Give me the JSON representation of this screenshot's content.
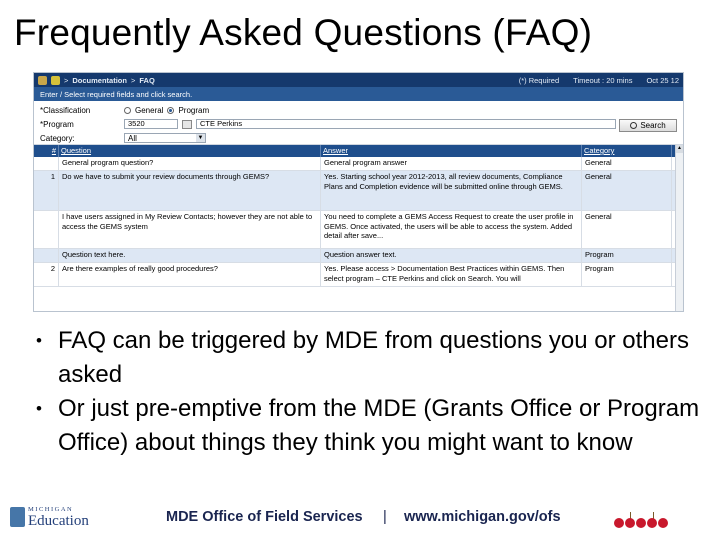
{
  "slide": {
    "title": "Frequently Asked Questions  (FAQ)",
    "bullets": [
      "FAQ can be triggered by MDE from questions you or others asked",
      "Or just pre-emptive from the MDE (Grants Office or Program Office) about things they think you might want to know"
    ],
    "bullet_glyph": "•"
  },
  "app": {
    "breadcrumb": [
      "Documentation",
      "FAQ"
    ],
    "crumb_sep": ">",
    "required_note": "(*) Required",
    "timeout": "Timeout : 20 mins",
    "date": "Oct 25 12",
    "instructions": "Enter / Select required fields and click search.",
    "form": {
      "classification_label": "*Classification",
      "classification_options": [
        "General",
        "Program"
      ],
      "classification_selected": "Program",
      "program_label": "*Program",
      "program_code": "3520",
      "program_name": "CTE Perkins",
      "category_label": "Category:",
      "category_value": "All",
      "search_label": "Search"
    },
    "grid": {
      "columns": [
        "#",
        "Question",
        "Answer",
        "Category"
      ],
      "rows": [
        {
          "num": "",
          "question": "General program question?",
          "answer": "General program answer",
          "category": "General",
          "highlight": false
        },
        {
          "num": "1",
          "question": "Do we have to submit your review documents through GEMS?",
          "answer": "Yes. Starting school year 2012-2013, all review documents, Compliance Plans and Completion evidence will be submitted online through GEMS.",
          "category": "General",
          "highlight": true
        },
        {
          "num": "",
          "question": "I have users assigned in My Review Contacts; however they are not able to access the GEMS system",
          "answer": "You need to complete a GEMS Access Request to create the user profile in GEMS. Once activated, the users will be able to access the system. Added detail after save...",
          "category": "General",
          "highlight": false
        },
        {
          "num": "",
          "question": "Question text here.",
          "answer": "Question answer text.",
          "category": "Program",
          "highlight": true
        },
        {
          "num": "2",
          "question": "Are there examples of really good procedures?",
          "answer": "Yes. Please access > Documentation Best Practices within GEMS. Then select program – CTE Perkins and click on Search. You will",
          "category": "Program",
          "highlight": false
        }
      ]
    }
  },
  "footer": {
    "logo_small": "MICHIGAN",
    "logo_big": "Education",
    "office": "MDE Office of Field Services",
    "separator": "|",
    "url": "www.michigan.gov/ofs"
  },
  "colors": {
    "header_navy": "#15396d",
    "instruction_blue": "#2a5a96",
    "grid_header": "#1f4e8c",
    "row_highlight": "#dde7f4",
    "footer_text": "#1a2550",
    "apple_red": "#c8182c"
  }
}
